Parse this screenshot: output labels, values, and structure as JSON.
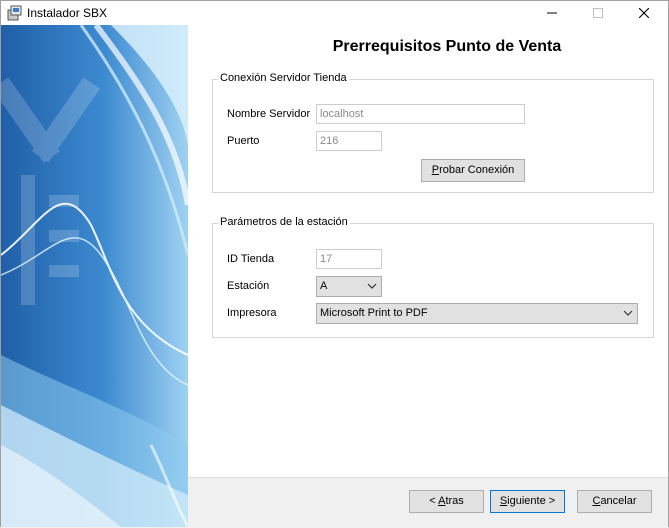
{
  "window": {
    "title": "Instalador SBX"
  },
  "page": {
    "heading": "Prerrequisitos Punto de Venta"
  },
  "server_group": {
    "legend": "Conexión Servidor Tienda",
    "server_name_label": "Nombre Servidor",
    "server_name_value": "localhost",
    "port_label": "Puerto",
    "port_value": "216",
    "test_button": {
      "access_key": "P",
      "rest": "robar Conexión"
    }
  },
  "station_group": {
    "legend": "Parámetros de la estación",
    "store_id_label": "ID Tienda",
    "store_id_value": "17",
    "station_label": "Estación",
    "station_value": "A",
    "printer_label": "Impresora",
    "printer_value": "Microsoft Print to PDF"
  },
  "footer": {
    "back": {
      "prefix": "< ",
      "access_key": "A",
      "rest": "tras"
    },
    "next": {
      "access_key": "S",
      "rest": "iguiente >"
    },
    "cancel": {
      "access_key": "C",
      "rest": "ancelar"
    }
  }
}
